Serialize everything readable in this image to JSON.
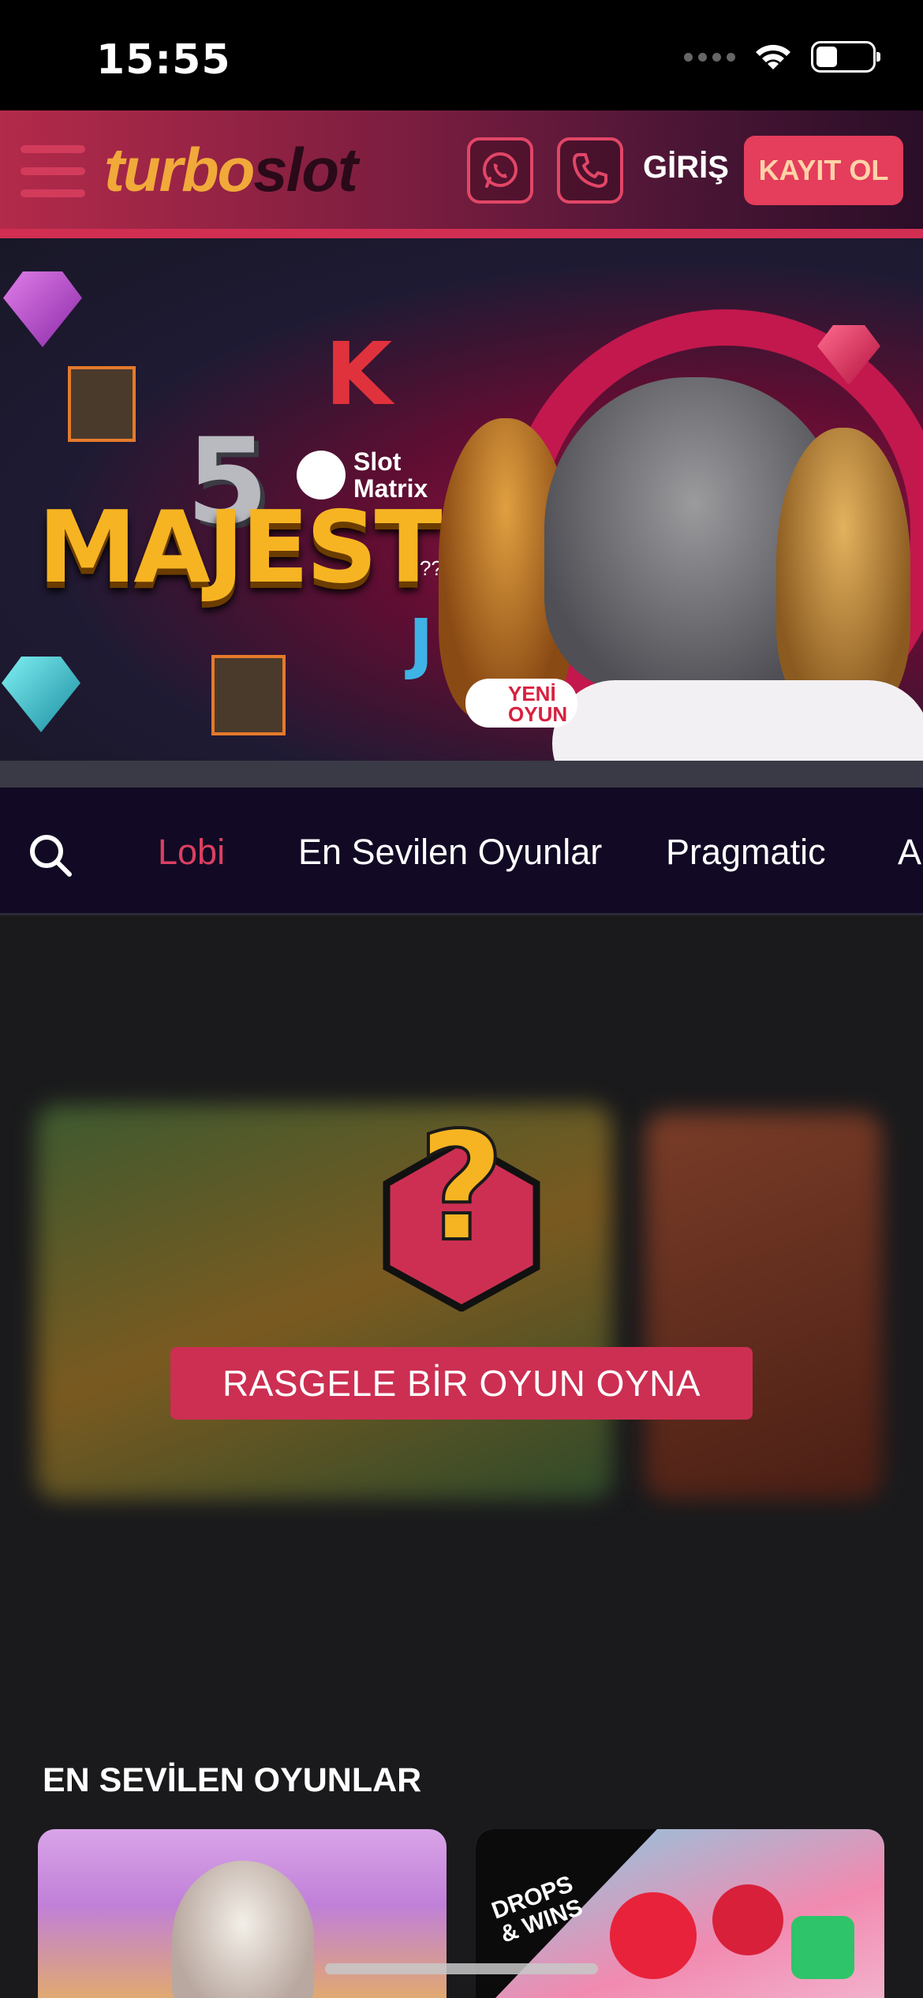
{
  "status_bar": {
    "time": "15:55"
  },
  "header": {
    "logo_part1": "turbo",
    "logo_part2": "slot",
    "login_label": "GİRİŞ",
    "register_label": "KAYIT OL"
  },
  "banner": {
    "number": "5",
    "title": "MAJESTIC",
    "provider_line1": "Slot",
    "provider_line2": "Matrix",
    "stars": "?????",
    "badge_line1": "YENİ",
    "badge_line2": "OYUN",
    "letter_k": "K",
    "letter_j": "J"
  },
  "nav": {
    "tabs": [
      {
        "label": "Lobi",
        "active": true
      },
      {
        "label": "En Sevilen Oyunlar",
        "active": false
      },
      {
        "label": "Pragmatic",
        "active": false
      },
      {
        "label": "Ap",
        "active": false
      }
    ]
  },
  "random_game": {
    "question_mark": "?",
    "button_label": "RASGELE BİR OYUN OYNA"
  },
  "section": {
    "title": "EN SEVİLEN OYUNLAR"
  },
  "games": [
    {
      "badge": ""
    },
    {
      "badge_line1": "DROPS",
      "badge_line2": "& WINS"
    }
  ],
  "colors": {
    "accent": "#dc3f62",
    "button": "#cc2f52",
    "logo_orange": "#f1a93a",
    "nav_bg": "#120a24"
  }
}
